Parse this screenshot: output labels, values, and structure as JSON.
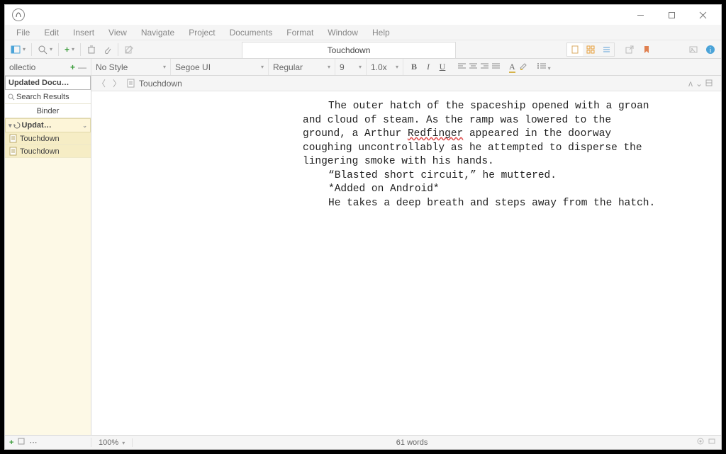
{
  "titlebar": {},
  "menubar": [
    "File",
    "Edit",
    "Insert",
    "View",
    "Navigate",
    "Project",
    "Documents",
    "Format",
    "Window",
    "Help"
  ],
  "toolbar": {
    "doc_tab": "Touchdown"
  },
  "formatbar": {
    "collections_label": "ollectio",
    "style": "No Style",
    "font": "Segoe UI",
    "weight": "Regular",
    "size": "9",
    "zoom": "1.0x",
    "bold": "B",
    "italic": "I",
    "underline": "U",
    "textcolor": "A"
  },
  "binder": {
    "tab_updated": "Updated Docu…",
    "search_results": "Search Results",
    "binder_label": "Binder",
    "folder": "Updat…",
    "items": [
      "Touchdown",
      "Touchdown"
    ]
  },
  "breadcrumb": {
    "doc": "Touchdown"
  },
  "editor": {
    "p1a": "The outer hatch of the spaceship opened with a groan",
    "p1b": "and cloud of steam. As the ramp was lowered to the",
    "p1c_pre": "ground, a Arthur ",
    "p1c_err": "Redfinger",
    "p1c_post": " appeared in the doorway",
    "p1d": "coughing uncontrollably as he attempted to disperse the",
    "p1e": "lingering smoke with his hands.",
    "p2": "“Blasted short circuit,” he muttered.",
    "p3": "*Added on Android*",
    "p4": "He takes a deep breath and steps away from the hatch."
  },
  "statusbar": {
    "zoom": "100%",
    "wordcount": "61 words"
  }
}
